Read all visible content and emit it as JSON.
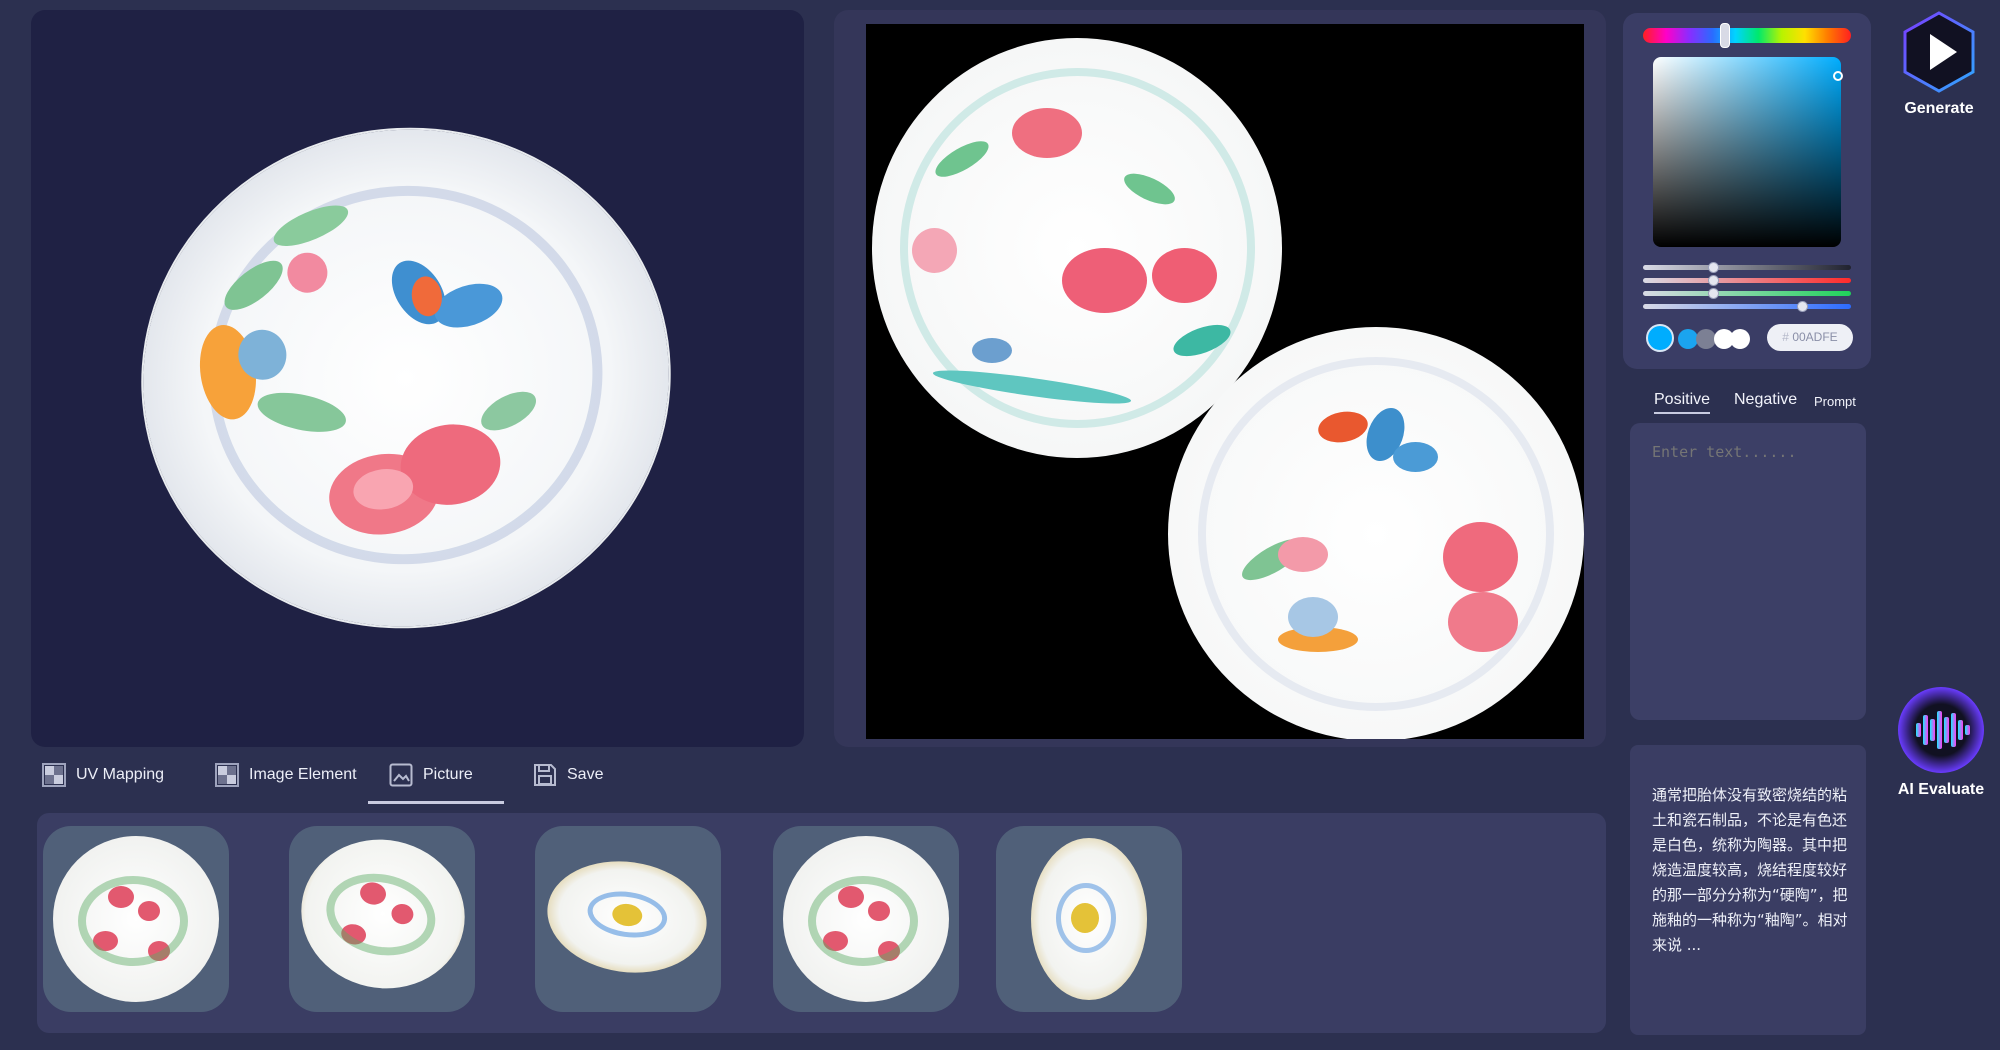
{
  "actions": {
    "generate_label": "Generate",
    "ai_evaluate_label": "AI Evaluate"
  },
  "color_picker": {
    "hex_value": "00ADFE",
    "hex_prefix": "#",
    "selected_color": "#00adfe"
  },
  "prompt": {
    "tabs": [
      {
        "label": "Positive",
        "active": true
      },
      {
        "label": "Negative",
        "active": false
      },
      {
        "label": "Prompt",
        "active": false
      }
    ],
    "placeholder": "Enter text......"
  },
  "ai_evaluate": {
    "text": "通常把胎体没有致密烧结的粘土和瓷石制品，不论是有色还是白色，统称为陶器。其中把烧造温度较高，烧结程度较好的那一部分分称为“硬陶”，把施釉的一种称为“釉陶”。相对来说 ..."
  },
  "toolbar": {
    "uv_mapping_label": "UV Mapping",
    "image_element_label": "Image Element",
    "picture_label": "Picture",
    "save_label": "Save",
    "active": "Picture"
  },
  "thumbnails": {
    "count": 5
  },
  "colors": {
    "background": "#2c3050",
    "viewport": "#1f2144",
    "panel": "#3a3d63",
    "accent": "#00adfe"
  }
}
